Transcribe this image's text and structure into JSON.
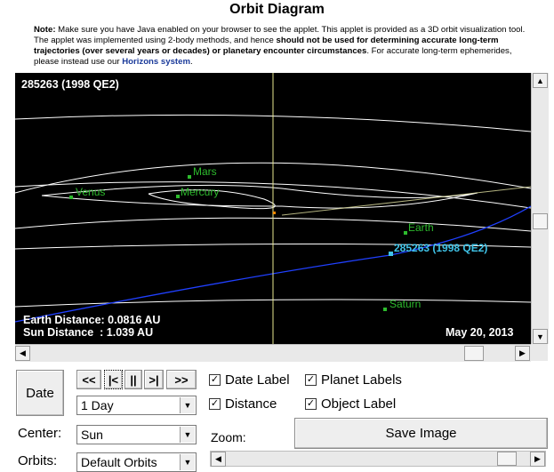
{
  "header": {
    "title": "Orbit Diagram",
    "note_label": "Note:",
    "note_part1": " Make sure you have Java enabled on your browser to see the applet. This applet is provided as a 3D orbit visualization tool. The applet was implemented using 2-body methods, and hence ",
    "note_bold": "should not be used for determining accurate long-term trajectories (over several years or decades) or planetary encounter circumstances",
    "note_part2": ". For accurate long-term ephemerides, please instead use our ",
    "note_link": "Horizons system",
    "note_end": "."
  },
  "viewport": {
    "object_title": "285263 (1998 QE2)",
    "earth_distance": "Earth Distance: 0.0816 AU",
    "sun_distance": "Sun Distance  : 1.039 AU",
    "date": "May 20, 2013",
    "labels": {
      "mars": "Mars",
      "venus": "Venus",
      "mercury": "Mercury",
      "earth": "Earth",
      "object": "285263 (1998 QE2)",
      "saturn": "Saturn"
    },
    "colors": {
      "planet": "#2dbb2d",
      "object": "#40c4e8",
      "orbit": "#ffffff",
      "object_orbit": "#2040ff"
    }
  },
  "controls": {
    "date_button": "Date",
    "nav": {
      "rewind": "<<",
      "step_back": "|<",
      "pause": "||",
      "step_fwd": ">|",
      "fast_fwd": ">>"
    },
    "step_select": "1 Day",
    "center_label": "Center:",
    "center_value": "Sun",
    "orbits_label": "Orbits:",
    "orbits_value": "Default Orbits",
    "checkboxes": {
      "date_label": "Date Label",
      "planet_labels": "Planet Labels",
      "distance": "Distance",
      "object_label": "Object Label"
    },
    "zoom_label": "Zoom:",
    "save_image": "Save Image"
  }
}
